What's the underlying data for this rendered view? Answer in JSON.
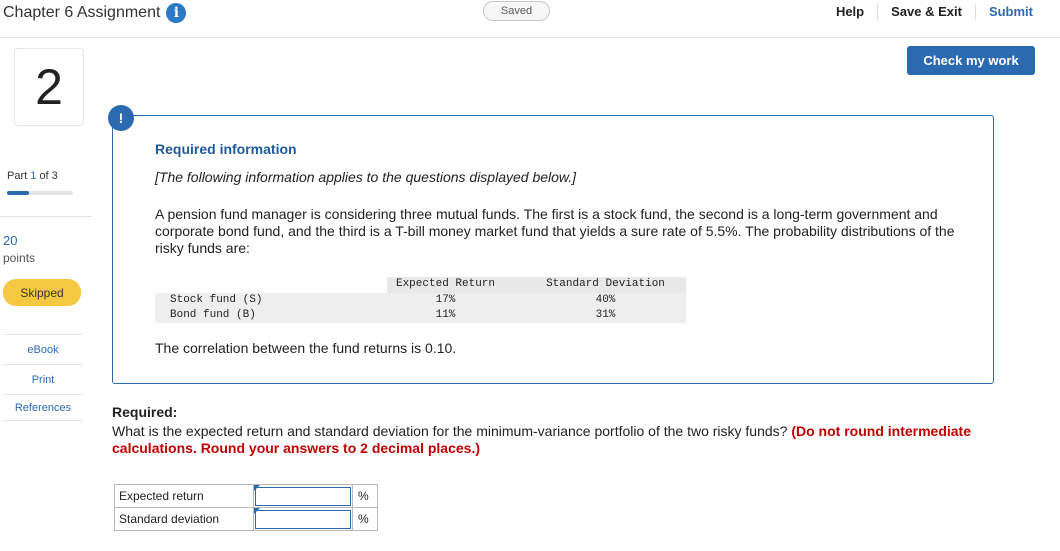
{
  "header": {
    "title": "Chapter 6 Assignment",
    "info_icon": "info-icon",
    "saved_label": "Saved",
    "help": "Help",
    "save_exit": "Save & Exit",
    "submit": "Submit"
  },
  "sidebar": {
    "question_number": "2",
    "part_word": "Part",
    "part_current": "1",
    "part_total": "of 3",
    "part_progress": 0.333,
    "points_value": "20",
    "points_label": "points",
    "status": "Skipped",
    "links": [
      "eBook",
      "Print",
      "References"
    ]
  },
  "check_button": "Check my work",
  "info_panel": {
    "alert_icon": "!",
    "title": "Required information",
    "italic_note": "[The following information applies to the questions displayed below.]",
    "paragraph": "A pension fund manager is considering three mutual funds. The first is a stock fund, the second is a long-term government and corporate bond fund, and the third is a T-bill money market fund that yields a sure rate of 5.5%. The probability distributions of the risky funds are:",
    "table": {
      "headers": [
        "",
        "Expected Return",
        "Standard Deviation"
      ],
      "rows": [
        [
          "Stock fund (S)",
          "17%",
          "40%"
        ],
        [
          "Bond fund (B)",
          "11%",
          "31%"
        ]
      ]
    },
    "correlation": "The correlation between the fund returns is 0.10."
  },
  "question": {
    "required_label": "Required:",
    "text": "What is the expected return and standard deviation for the minimum-variance portfolio of the two risky funds?",
    "instruction": "(Do not round intermediate calculations. Round your answers to 2 decimal places.)"
  },
  "answers": [
    {
      "label": "Expected return",
      "value": "",
      "unit": "%"
    },
    {
      "label": "Standard deviation",
      "value": "",
      "unit": "%"
    }
  ],
  "colors": {
    "accent": "#2b6ab1",
    "skipped": "#f5c842",
    "warning_text": "#c00000"
  }
}
